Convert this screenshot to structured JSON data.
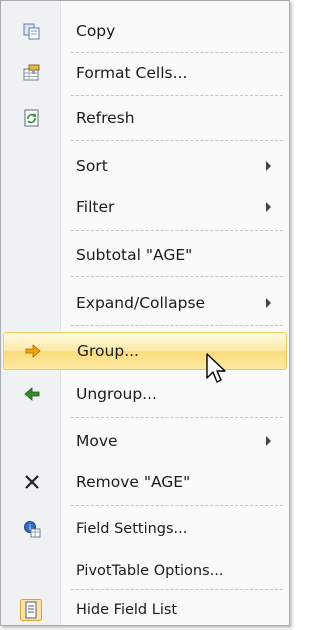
{
  "menu": {
    "items": [
      {
        "id": "copy",
        "label": "Copy",
        "icon": "copy-icon"
      },
      {
        "id": "format-cells",
        "label": "Format Cells...",
        "icon": "format-cells-icon"
      },
      {
        "id": "refresh",
        "label": "Refresh",
        "icon": "refresh-icon"
      },
      {
        "id": "sort",
        "label": "Sort",
        "submenu": true
      },
      {
        "id": "filter",
        "label": "Filter",
        "submenu": true
      },
      {
        "id": "subtotal",
        "label": "Subtotal \"AGE\""
      },
      {
        "id": "expand-collapse",
        "label": "Expand/Collapse",
        "submenu": true
      },
      {
        "id": "group",
        "label": "Group...",
        "icon": "group-arrow-icon",
        "highlighted": true
      },
      {
        "id": "ungroup",
        "label": "Ungroup...",
        "icon": "ungroup-arrow-icon"
      },
      {
        "id": "move",
        "label": "Move",
        "submenu": true
      },
      {
        "id": "remove",
        "label": "Remove \"AGE\"",
        "icon": "remove-x-icon"
      },
      {
        "id": "field-settings",
        "label": "Field Settings...",
        "icon": "field-settings-icon"
      },
      {
        "id": "pivottable-options",
        "label": "PivotTable Options..."
      },
      {
        "id": "hide-field-list",
        "label": "Hide Field List",
        "icon": "field-list-icon"
      }
    ]
  },
  "colors": {
    "highlight_border": "#f2ca58",
    "highlight_fill": "#fde9a3",
    "gutter": "#f0f1f3",
    "group_arrow": "#f0a30a",
    "ungroup_arrow": "#3a8a2a"
  }
}
